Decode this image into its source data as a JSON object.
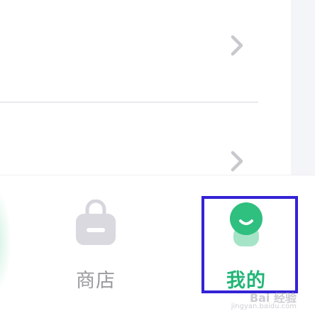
{
  "list": {
    "rows": [
      {
        "chevron_icon": "chevron-right-icon"
      },
      {
        "chevron_icon": "chevron-right-icon"
      }
    ]
  },
  "tabbar": {
    "tabs": [
      {
        "label": "商店",
        "icon": "shopping-bag-icon",
        "active": false
      },
      {
        "label": "我的",
        "icon": "profile-smile-icon",
        "active": true
      }
    ]
  },
  "annotation": {
    "box_color": "#3322d6"
  },
  "watermark": {
    "logo": "Bai 经验",
    "url": "jingyan.baidu.com"
  },
  "colors": {
    "active_tab": "#21b577",
    "inactive_tab": "#9a9aa0",
    "background": "#ffffff",
    "side_strip": "#f4f5f9"
  }
}
